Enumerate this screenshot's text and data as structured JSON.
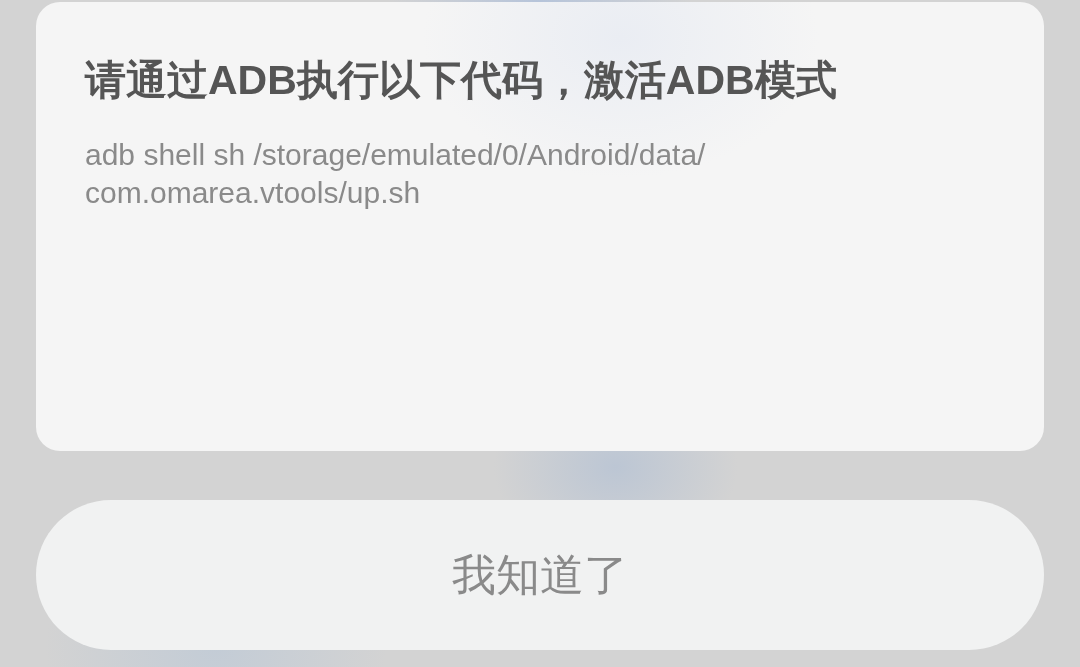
{
  "dialog": {
    "title": "请通过ADB执行以下代码，激活ADB模式",
    "message": "adb shell sh /storage/emulated/0/Android/data/com.omarea.vtools/up.sh"
  },
  "button": {
    "label": "我知道了"
  }
}
